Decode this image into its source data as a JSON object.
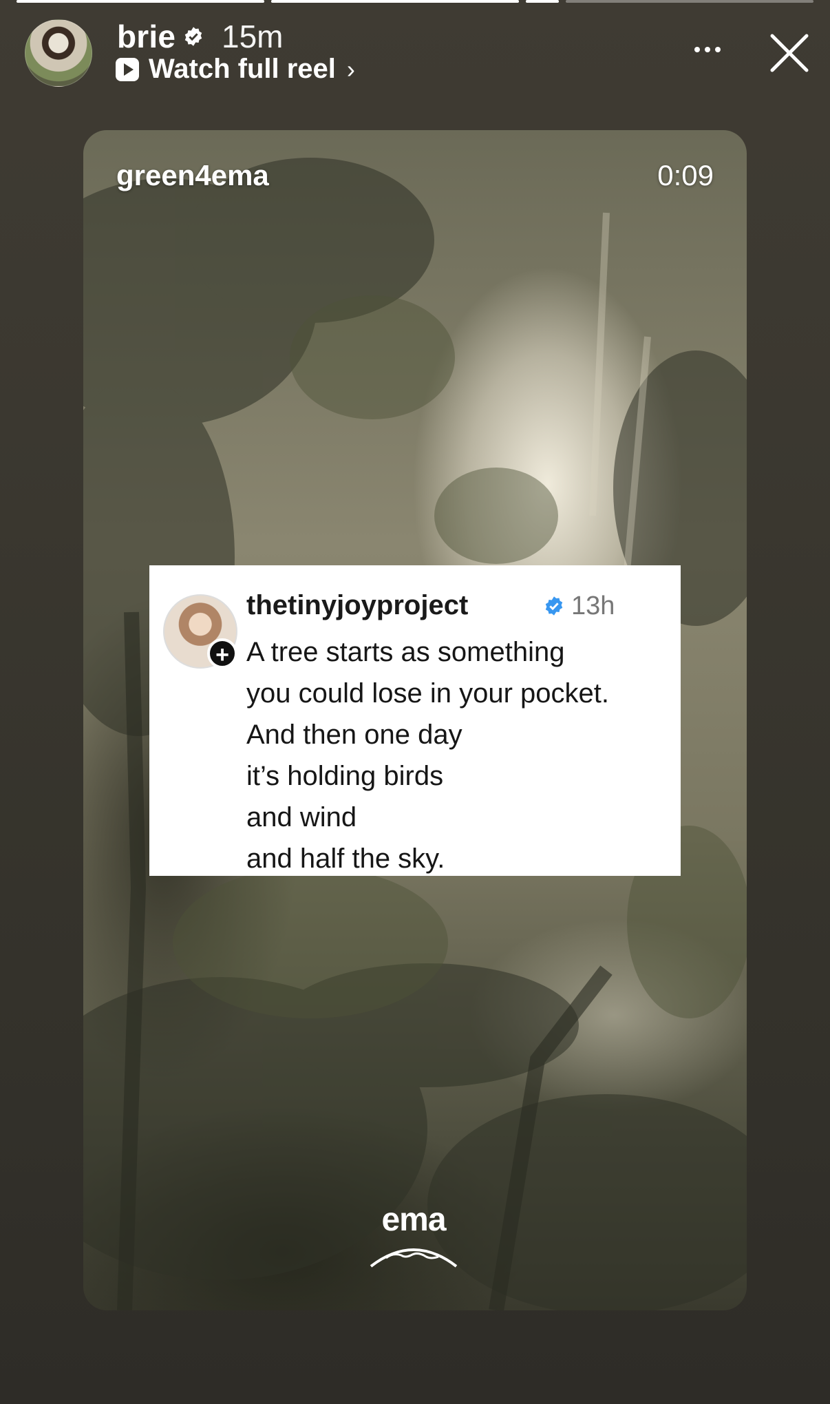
{
  "progress": {
    "segments_complete": 3,
    "current_fraction": 1.0,
    "segments": 4
  },
  "header": {
    "username": "brie",
    "time_ago": "15m",
    "watch_label": "Watch full reel",
    "watch_chevron": "›",
    "more_icon": "more-horizontal-icon",
    "close_icon": "close-icon"
  },
  "reel": {
    "creator": "green4ema",
    "timestamp": "0:09",
    "watermark": "ema"
  },
  "post": {
    "handle": "thetinyjoyproject",
    "time_ago": "13h",
    "plus": "+",
    "lines": [
      "A tree starts as something",
      "you could lose in your pocket.",
      "And then one day",
      "it’s holding birds",
      "and wind",
      "and half the sky."
    ]
  },
  "colors": {
    "background": "#3b3830",
    "verified_blue": "#3897f0",
    "text": "#ffffff"
  }
}
